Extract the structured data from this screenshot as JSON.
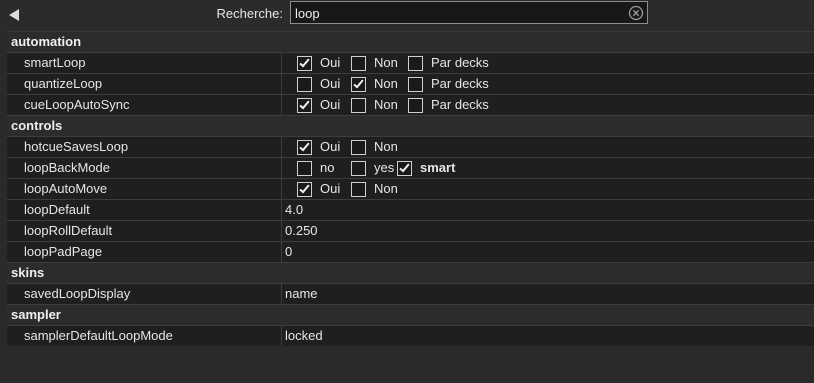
{
  "search": {
    "label": "Recherche:",
    "value": "loop"
  },
  "sections": [
    {
      "title": "automation",
      "rows": [
        {
          "key": "smartLoop",
          "options": [
            {
              "label": "Oui",
              "checked": true
            },
            {
              "label": "Non",
              "checked": false
            },
            {
              "label": "Par decks",
              "checked": false
            }
          ]
        },
        {
          "key": "quantizeLoop",
          "options": [
            {
              "label": "Oui",
              "checked": false
            },
            {
              "label": "Non",
              "checked": true
            },
            {
              "label": "Par decks",
              "checked": false
            }
          ]
        },
        {
          "key": "cueLoopAutoSync",
          "options": [
            {
              "label": "Oui",
              "checked": true
            },
            {
              "label": "Non",
              "checked": false
            },
            {
              "label": "Par decks",
              "checked": false
            }
          ]
        }
      ]
    },
    {
      "title": "controls",
      "rows": [
        {
          "key": "hotcueSavesLoop",
          "options": [
            {
              "label": "Oui",
              "checked": true
            },
            {
              "label": "Non",
              "checked": false
            }
          ]
        },
        {
          "key": "loopBackMode",
          "options": [
            {
              "label": "no",
              "checked": false
            },
            {
              "label": "yes",
              "checked": false
            },
            {
              "label": "smart",
              "checked": true,
              "bold": true
            }
          ]
        },
        {
          "key": "loopAutoMove",
          "options": [
            {
              "label": "Oui",
              "checked": true
            },
            {
              "label": "Non",
              "checked": false
            }
          ]
        },
        {
          "key": "loopDefault",
          "value": "4.0"
        },
        {
          "key": "loopRollDefault",
          "value": "0.250"
        },
        {
          "key": "loopPadPage",
          "value": "0"
        }
      ]
    },
    {
      "title": "skins",
      "rows": [
        {
          "key": "savedLoopDisplay",
          "value": "name"
        }
      ]
    },
    {
      "title": "sampler",
      "rows": [
        {
          "key": "samplerDefaultLoopMode",
          "value": "locked"
        }
      ]
    }
  ]
}
